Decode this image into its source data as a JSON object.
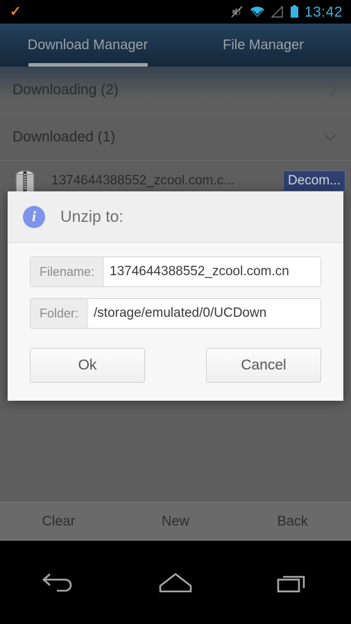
{
  "status_bar": {
    "notification_icon": "check-icon",
    "icons": [
      "mute-icon",
      "wifi-icon",
      "signal-icon",
      "battery-icon"
    ],
    "time": "13:42",
    "time_color": "#33b5e5"
  },
  "tabs": [
    {
      "label": "Download Manager",
      "active": true
    },
    {
      "label": "File Manager",
      "active": false
    }
  ],
  "groups": [
    {
      "label": "Downloading (2)",
      "chevron": "chevron-right-icon",
      "expanded": false
    },
    {
      "label": "Downloaded (1)",
      "chevron": "chevron-down-icon",
      "expanded": true
    }
  ],
  "file_row": {
    "icon": "zip-file-icon",
    "name": "1374644388552_zcool.com.c...",
    "action_label": "Decom...",
    "action_color": "#2f3f6e"
  },
  "dialog": {
    "icon": "info-icon",
    "icon_color": "#7e93ec",
    "title": "Unzip to:",
    "fields": [
      {
        "label": "Filename:",
        "value": "1374644388552_zcool.com.cn"
      },
      {
        "label": "Folder:",
        "value": "/storage/emulated/0/UCDown"
      }
    ],
    "ok_label": "Ok",
    "cancel_label": "Cancel"
  },
  "bottom_bar": {
    "buttons": [
      "Clear",
      "New",
      "Back"
    ]
  },
  "nav_bar": {
    "buttons": [
      "back-nav-icon",
      "home-nav-icon",
      "recents-nav-icon"
    ]
  }
}
